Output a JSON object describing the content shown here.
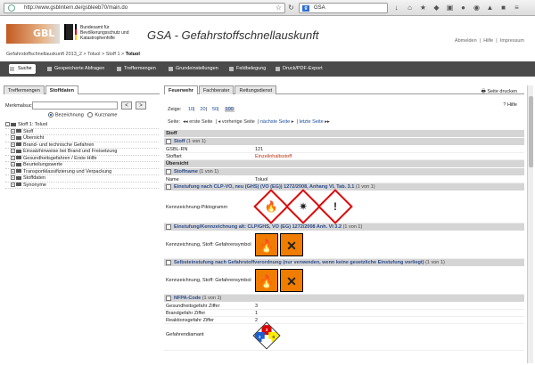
{
  "browser": {
    "url": "http://www.gsblintern.de/gsbleeb70/main.do",
    "search": "GSA"
  },
  "header": {
    "agency": "Bundesamt für Bevölkerungsschutz und Katastrophenhilfe",
    "logo_text": "GBL",
    "title": "GSA - Gefahrstoffschnellauskunft",
    "links": [
      "Abmelden",
      "Hilfe",
      "Impressum"
    ],
    "breadcrumb": "Gefahrstoffschnellauskunft 2013_2 > Toluol > Stoff 1 >",
    "breadcrumb_current": "Toluol"
  },
  "nav": [
    "Suche",
    "Gespeicherte Abfragen",
    "Treffermengen",
    "Grundeinstellungen",
    "Feldbelegung",
    "Druck/PDF-Export"
  ],
  "left": {
    "tabs": [
      "Treffermengen",
      "Stoffdaten"
    ],
    "merkmal_label": "Merkmalsuche:",
    "radio_1": "Bezeichnung",
    "radio_2": "Kurzname",
    "tree_root": "Stoff 1: Toluol",
    "tree": [
      "Stoff",
      "Übersicht",
      "Brand- und technische Gefahren",
      "Einsatzhinweise bei Brand und Freisetzung",
      "Gesundheitsgefahren / Erste Hilfe",
      "Beurteilungswerte",
      "Transportklassifizierung und Verpackung",
      "Stoffdaten",
      "Synonyme"
    ]
  },
  "right": {
    "tabs": [
      "Feuerwehr",
      "Fachberater",
      "Rettungsdienst"
    ],
    "print": "Seite drucken",
    "help": "Hilfe",
    "zeige_label": "Zeige:",
    "page_sizes": [
      "10",
      "20",
      "50",
      "100"
    ],
    "seite_label": "Seite:",
    "first": "erste Seite",
    "prev": "vorherige Seite",
    "next": "nächste Seite",
    "last": "letzte Seite",
    "sections": {
      "stoff": "Stoff",
      "stoff_sub": "Stoff",
      "stoff_cnt": "(1 von 1)",
      "gsbl_rn_k": "GSBL-RN",
      "gsbl_rn_v": "121",
      "stoffart_k": "Stoffart",
      "stoffart_v": "Einzelinhaltsstoff",
      "uebersicht": "Übersicht",
      "stoffname": "Stoffname",
      "stoffname_cnt": "(1 von 1)",
      "name_k": "Name",
      "name_v": "Toluol",
      "clp_new": "Einstufung nach CLP-VO, neu (GHS) (VO (EG)) 1272/2008, Anhang VI, Tab. 3.1",
      "clp_new_cnt": "(1 von 1)",
      "pikto_k": "Kennzeichnung-Piktogramm",
      "clp_alt": "Einstufung/Kennzeichnung alt: CLP/GHS, VO (EG) 1272/2008 Anh. VI 3.2",
      "clp_alt_cnt": "(1 von 1)",
      "symbol_k": "Kennzeichnung, Stoff: Gefahrensymbol",
      "selbst": "Selbsteinstufung nach Gefahrstoffverordnung (nur verwenden, wenn keine gesetzliche Einstufung vorliegt)",
      "selbst_cnt": "(1 von 1)",
      "symbol_k2": "Kennzeichnung, Stoff: Gefahrensymbol",
      "nfpa": "NFPA-Code",
      "nfpa_cnt": "(1 von 1)",
      "g_k": "Gesundheitsgefahr Ziffer",
      "g_v": "3",
      "b_k": "Brandgefahr Ziffer",
      "b_v": "1",
      "r_k": "Reaktionsgefahr Ziffer",
      "r_v": "2",
      "diamant_k": "Gefahrendiamant",
      "nfpa_h": "2",
      "nfpa_f": "3",
      "nfpa_r": "0"
    }
  }
}
